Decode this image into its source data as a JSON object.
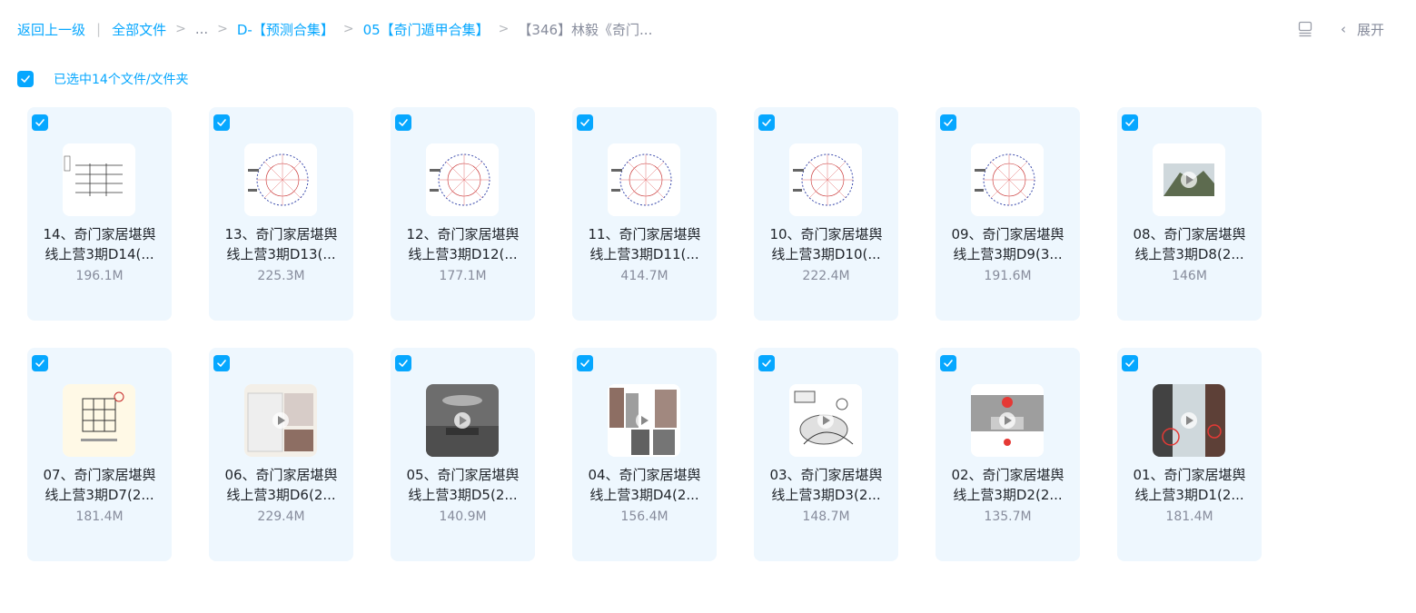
{
  "breadcrumb": {
    "back": "返回上一级",
    "divider": "|",
    "all_files": "全部文件",
    "ellipsis": "...",
    "folder1": "D-【预测合集】",
    "folder2": "05【奇门遁甲合集】",
    "current": "【346】林毅《奇门...",
    "arrow": ">"
  },
  "toolbar": {
    "expand_label": "展开",
    "chevron": "‹",
    "list_view_icon": "list-view-icon"
  },
  "selection": {
    "label": "已选中14个文件/文件夹"
  },
  "accent_color": "#06a7ff",
  "files": [
    {
      "line1": "14、奇门家居堪舆",
      "line2": "线上营3期D14(...",
      "size": "196.1M",
      "thumb": "table"
    },
    {
      "line1": "13、奇门家居堪舆",
      "line2": "线上营3期D13(...",
      "size": "225.3M",
      "thumb": "chart"
    },
    {
      "line1": "12、奇门家居堪舆",
      "line2": "线上营3期D12(...",
      "size": "177.1M",
      "thumb": "chart"
    },
    {
      "line1": "11、奇门家居堪舆",
      "line2": "线上营3期D11(...",
      "size": "414.7M",
      "thumb": "chart"
    },
    {
      "line1": "10、奇门家居堪舆",
      "line2": "线上营3期D10(...",
      "size": "222.4M",
      "thumb": "chart"
    },
    {
      "line1": "09、奇门家居堪舆",
      "line2": "线上营3期D9(3...",
      "size": "191.6M",
      "thumb": "chart"
    },
    {
      "line1": "08、奇门家居堪舆",
      "line2": "线上营3期D8(2...",
      "size": "146M",
      "thumb": "mountain"
    },
    {
      "line1": "07、奇门家居堪舆",
      "line2": "线上营3期D7(2...",
      "size": "181.4M",
      "thumb": "grid"
    },
    {
      "line1": "06、奇门家居堪舆",
      "line2": "线上营3期D6(2...",
      "size": "229.4M",
      "thumb": "room"
    },
    {
      "line1": "05、奇门家居堪舆",
      "line2": "线上营3期D5(2...",
      "size": "140.9M",
      "thumb": "interior"
    },
    {
      "line1": "04、奇门家居堪舆",
      "line2": "线上营3期D4(2...",
      "size": "156.4M",
      "thumb": "buildings"
    },
    {
      "line1": "03、奇门家居堪舆",
      "line2": "线上营3期D3(2...",
      "size": "148.7M",
      "thumb": "sketch"
    },
    {
      "line1": "02、奇门家居堪舆",
      "line2": "线上营3期D2(2...",
      "size": "135.7M",
      "thumb": "photo"
    },
    {
      "line1": "01、奇门家居堪舆",
      "line2": "线上营3期D1(2...",
      "size": "181.4M",
      "thumb": "street"
    }
  ]
}
